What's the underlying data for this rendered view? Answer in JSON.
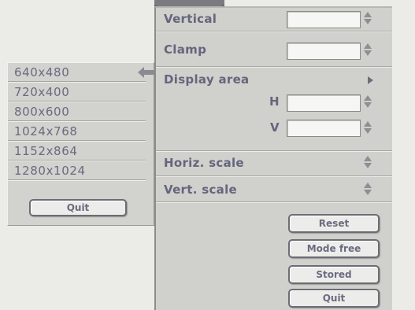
{
  "main_panel": {
    "rows": {
      "vertical": "Vertical",
      "clamp": "Clamp",
      "display_area": "Display area",
      "h": "H",
      "v": "V",
      "horiz_scale": "Horiz. scale",
      "vert_scale": "Vert. scale"
    },
    "buttons": {
      "reset": "Reset",
      "mode_free": "Mode free",
      "stored": "Stored",
      "quit": "Quit"
    }
  },
  "resolution_menu": {
    "items": [
      "640x480",
      "720x400",
      "800x600",
      "1024x768",
      "1152x864",
      "1280x1024"
    ],
    "selected_index": 0,
    "quit": "Quit"
  },
  "icons": {
    "spinner": "up-down-spinner-icon",
    "submenu": "submenu-arrow-icon",
    "selected": "selected-arrow-icon"
  },
  "colors": {
    "panel": "#d0d0cc",
    "text": "#65657d",
    "background": "#ebebe7",
    "arrow": "#5a5a60"
  }
}
